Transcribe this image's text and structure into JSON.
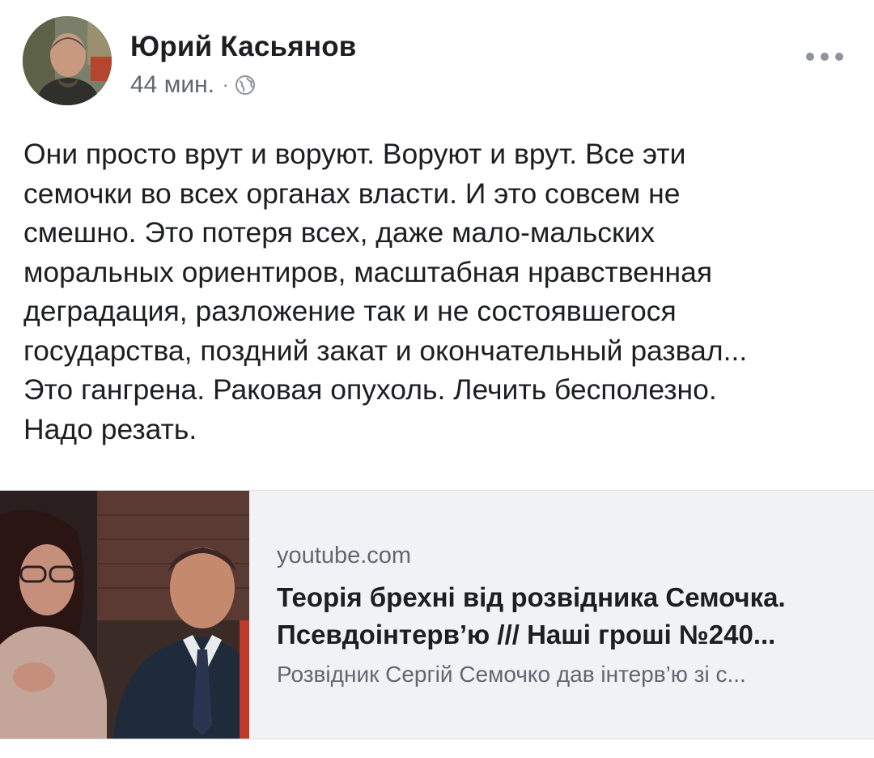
{
  "post": {
    "author": "Юрий Касьянов",
    "time": "44 мин.",
    "separator": "·",
    "privacy_icon": "globe-icon",
    "more_icon": "more-options-icon",
    "text": "Они просто врут и воруют. Воруют и врут. Все эти\nсемочки во всех органах власти. И это совсем не\nсмешно. Это потеря всех, даже мало-мальских\nморальных ориентиров, масштабная нравственная\nдеградация, разложение так и не состоявшегося\nгосударства, поздний закат и окончательный развал...\nЭто гангрена. Раковая опухоль. Лечить бесполезно.\nНадо резать."
  },
  "link_preview": {
    "domain": "youtube.com",
    "title_line1": "Теорія брехні від розвідника Семочка.",
    "title_line2": "Псевдоінтерв’ю /// Наші гроші №240...",
    "description": "Розвідник Сергій Семочко дав інтерв’ю зі с..."
  },
  "colors": {
    "text_primary": "#1c1e21",
    "text_secondary": "#606770",
    "card_background": "#f0f2f5"
  }
}
